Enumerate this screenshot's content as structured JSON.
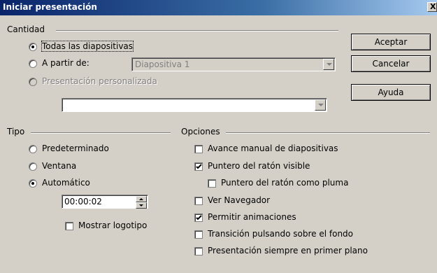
{
  "window": {
    "title": "Iniciar presentación",
    "close_glyph": "X"
  },
  "buttons": {
    "ok": "Aceptar",
    "cancel": "Cancelar",
    "help": "Ayuda"
  },
  "cantidad": {
    "label": "Cantidad",
    "all_slides": "Todas las diapositivas",
    "from": "A partir de:",
    "from_value": "Diapositiva 1",
    "custom": "Presentación personalizada",
    "custom_value": "",
    "selected": "all_slides"
  },
  "tipo": {
    "label": "Tipo",
    "options": [
      "Predeterminado",
      "Ventana",
      "Automático"
    ],
    "selected": "Automático",
    "pause_value": "00:00:02",
    "show_logo": "Mostrar logotipo",
    "show_logo_checked": false
  },
  "opciones": {
    "label": "Opciones",
    "items": [
      {
        "label": "Avance manual de diapositivas",
        "checked": false
      },
      {
        "label": "Puntero del ratón visible",
        "checked": true
      },
      {
        "label": "Puntero del ratón como pluma",
        "checked": false
      },
      {
        "label": "Ver Navegador",
        "checked": false
      },
      {
        "label": "Permitir animaciones",
        "checked": true
      },
      {
        "label": "Transición pulsando sobre el fondo",
        "checked": false
      },
      {
        "label": "Presentación siempre en primer plano",
        "checked": false
      }
    ]
  }
}
